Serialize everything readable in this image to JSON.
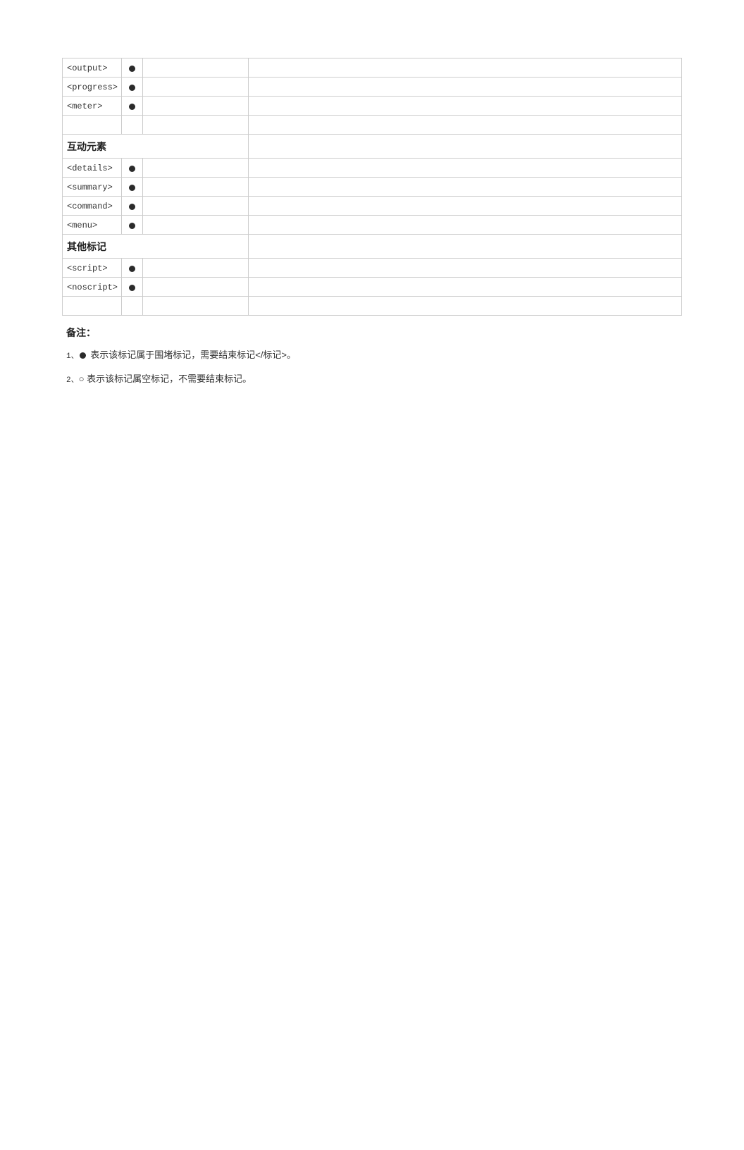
{
  "rows_top": [
    {
      "tag": "<output>",
      "dot": true
    },
    {
      "tag": "<progress>",
      "dot": true
    },
    {
      "tag": "<meter>",
      "dot": true
    },
    {
      "tag": "",
      "dot": false
    }
  ],
  "section1_title": "互动元素",
  "rows_section1": [
    {
      "tag": "<details>",
      "dot": true
    },
    {
      "tag": "<summary>",
      "dot": true
    },
    {
      "tag": "<command>",
      "dot": true
    },
    {
      "tag": "<menu>",
      "dot": true
    }
  ],
  "section2_title": "其他标记",
  "rows_section2": [
    {
      "tag": "<script>",
      "dot": true
    },
    {
      "tag": "<noscript>",
      "dot": true
    },
    {
      "tag": "",
      "dot": false
    }
  ],
  "notes": {
    "title": "备注：",
    "line1_num": "1、",
    "line1_text": " 表示该标记属于围堵标记，需要结束标记</标记>。",
    "line2_num": "2、",
    "line2_symbol": "○",
    "line2_text": " 表示该标记属空标记，不需要结束标记。"
  }
}
